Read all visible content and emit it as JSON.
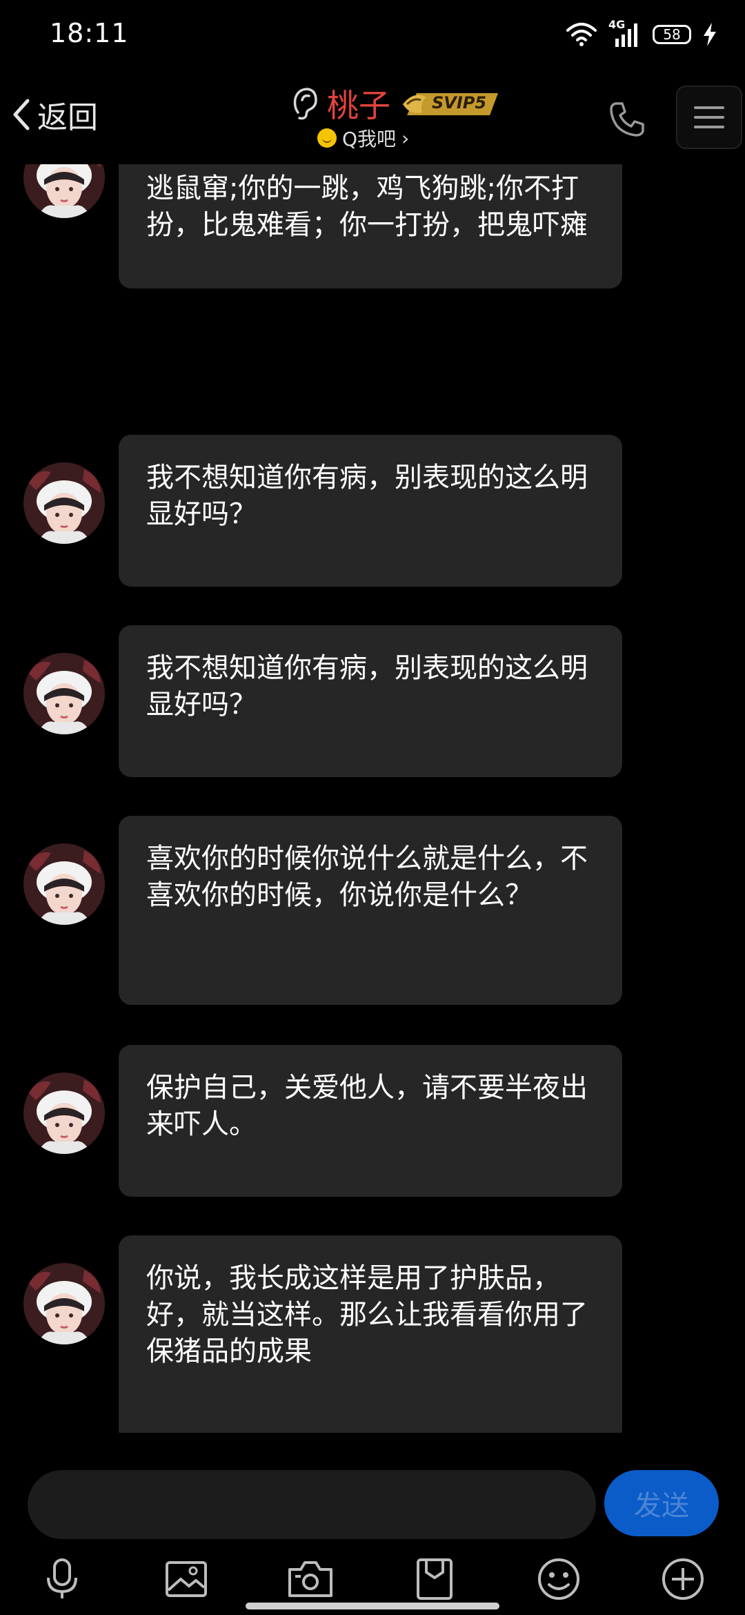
{
  "status_bar": {
    "time": "18:11",
    "network_label": "4G",
    "battery_level": "58",
    "charging": true
  },
  "header": {
    "back_label": "返回",
    "contact_name": "桃子",
    "vip_label": "SVIP5",
    "subtitle": "Q我吧",
    "subtitle_chevron": "›",
    "icons": [
      "back-chevron-icon",
      "ear-icon",
      "phone-icon",
      "menu-icon"
    ]
  },
  "messages": [
    {
      "sender": "桃子",
      "text": "你的一笑，狼都上吊：你的一叹，猫逃鼠窜;你的一跳，鸡飞狗跳;你不打扮，比鬼难看；你一打扮，把鬼吓瘫"
    },
    {
      "sender": "桃子",
      "text": "我不想知道你有病，别表现的这么明显好吗？"
    },
    {
      "sender": "桃子",
      "text": "我不想知道你有病，别表现的这么明显好吗？"
    },
    {
      "sender": "桃子",
      "text": "喜欢你的时候你说什么就是什么，不喜欢你的时候，你说你是什么？"
    },
    {
      "sender": "桃子",
      "text": "保护自己，关爱他人，请不要半夜出来吓人。"
    },
    {
      "sender": "桃子",
      "text": "你说，我长成这样是用了护肤品，好，就当这样。那么让我看看你用了保猪品的成果"
    }
  ],
  "composer": {
    "input_value": "",
    "send_label": "发送"
  },
  "toolbar": {
    "tools": [
      "microphone-icon",
      "image-icon",
      "camera-icon",
      "file-icon",
      "emoji-icon",
      "plus-icon"
    ]
  },
  "colors": {
    "background": "#000000",
    "bubble": "#262626",
    "name": "#e2443c",
    "send": "#0b5cc9",
    "vip_gold": "#c59a2c"
  }
}
